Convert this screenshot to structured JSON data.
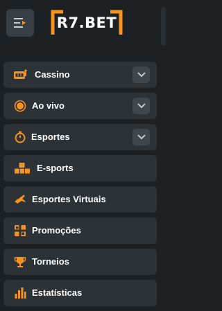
{
  "header": {
    "logo_text": "R7.BET",
    "menu_toggle_icon": "menu-toggle-icon",
    "brand_color": "#f7931e"
  },
  "menu": {
    "items": [
      {
        "label": "Cassino",
        "icon": "slot-machine-icon",
        "expandable": true
      },
      {
        "label": "Ao vivo",
        "icon": "live-dot-icon",
        "expandable": true
      },
      {
        "label": "Esportes",
        "icon": "stopwatch-icon",
        "expandable": true
      },
      {
        "label": "E-sports",
        "icon": "blocks-icon",
        "expandable": false
      },
      {
        "label": "Esportes Virtuais",
        "icon": "racing-horse-icon",
        "expandable": false
      },
      {
        "label": "Promoções",
        "icon": "gift-icon",
        "expandable": false
      },
      {
        "label": "Torneios",
        "icon": "trophy-icon",
        "expandable": false
      },
      {
        "label": "Estatísticas",
        "icon": "bar-chart-icon",
        "expandable": false
      }
    ]
  },
  "colors": {
    "background": "#1d2124",
    "item_background": "#2d3236",
    "accent": "#f7931e",
    "text": "#ffffff"
  }
}
